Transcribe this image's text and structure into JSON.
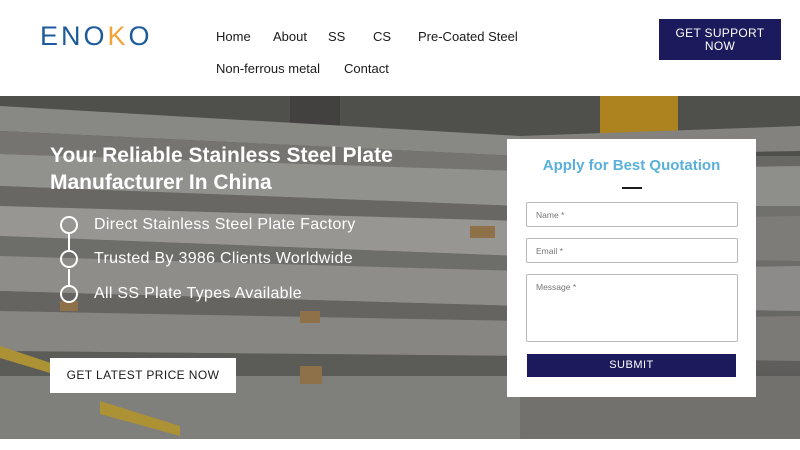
{
  "header": {
    "logo": "ENOKO",
    "nav": [
      {
        "label": "Home"
      },
      {
        "label": "About"
      },
      {
        "label": "SS"
      },
      {
        "label": "CS"
      },
      {
        "label": "Pre-Coated Steel"
      },
      {
        "label": "Non-ferrous metal"
      },
      {
        "label": "Contact"
      }
    ],
    "support_button": "GET SUPPORT NOW"
  },
  "hero": {
    "title": "Your Reliable Stainless Steel Plate Manufacturer In China",
    "bullets": [
      {
        "text": "Direct Stainless Steel Plate Factory"
      },
      {
        "text": "Trusted By 3986 Clients Worldwide"
      },
      {
        "text": "All SS Plate Types Available"
      }
    ],
    "cta_button": "GET LATEST PRICE NOW"
  },
  "quote_form": {
    "title": "Apply for Best Quotation",
    "name_placeholder": "Name *",
    "email_placeholder": "Email *",
    "message_placeholder": "Message *",
    "submit_label": "SUBMIT"
  },
  "colors": {
    "brand_navy": "#1a1a5c",
    "logo_blue": "#1e5b9c",
    "logo_accent": "#f2a43a",
    "form_title": "#5ab0d8"
  }
}
